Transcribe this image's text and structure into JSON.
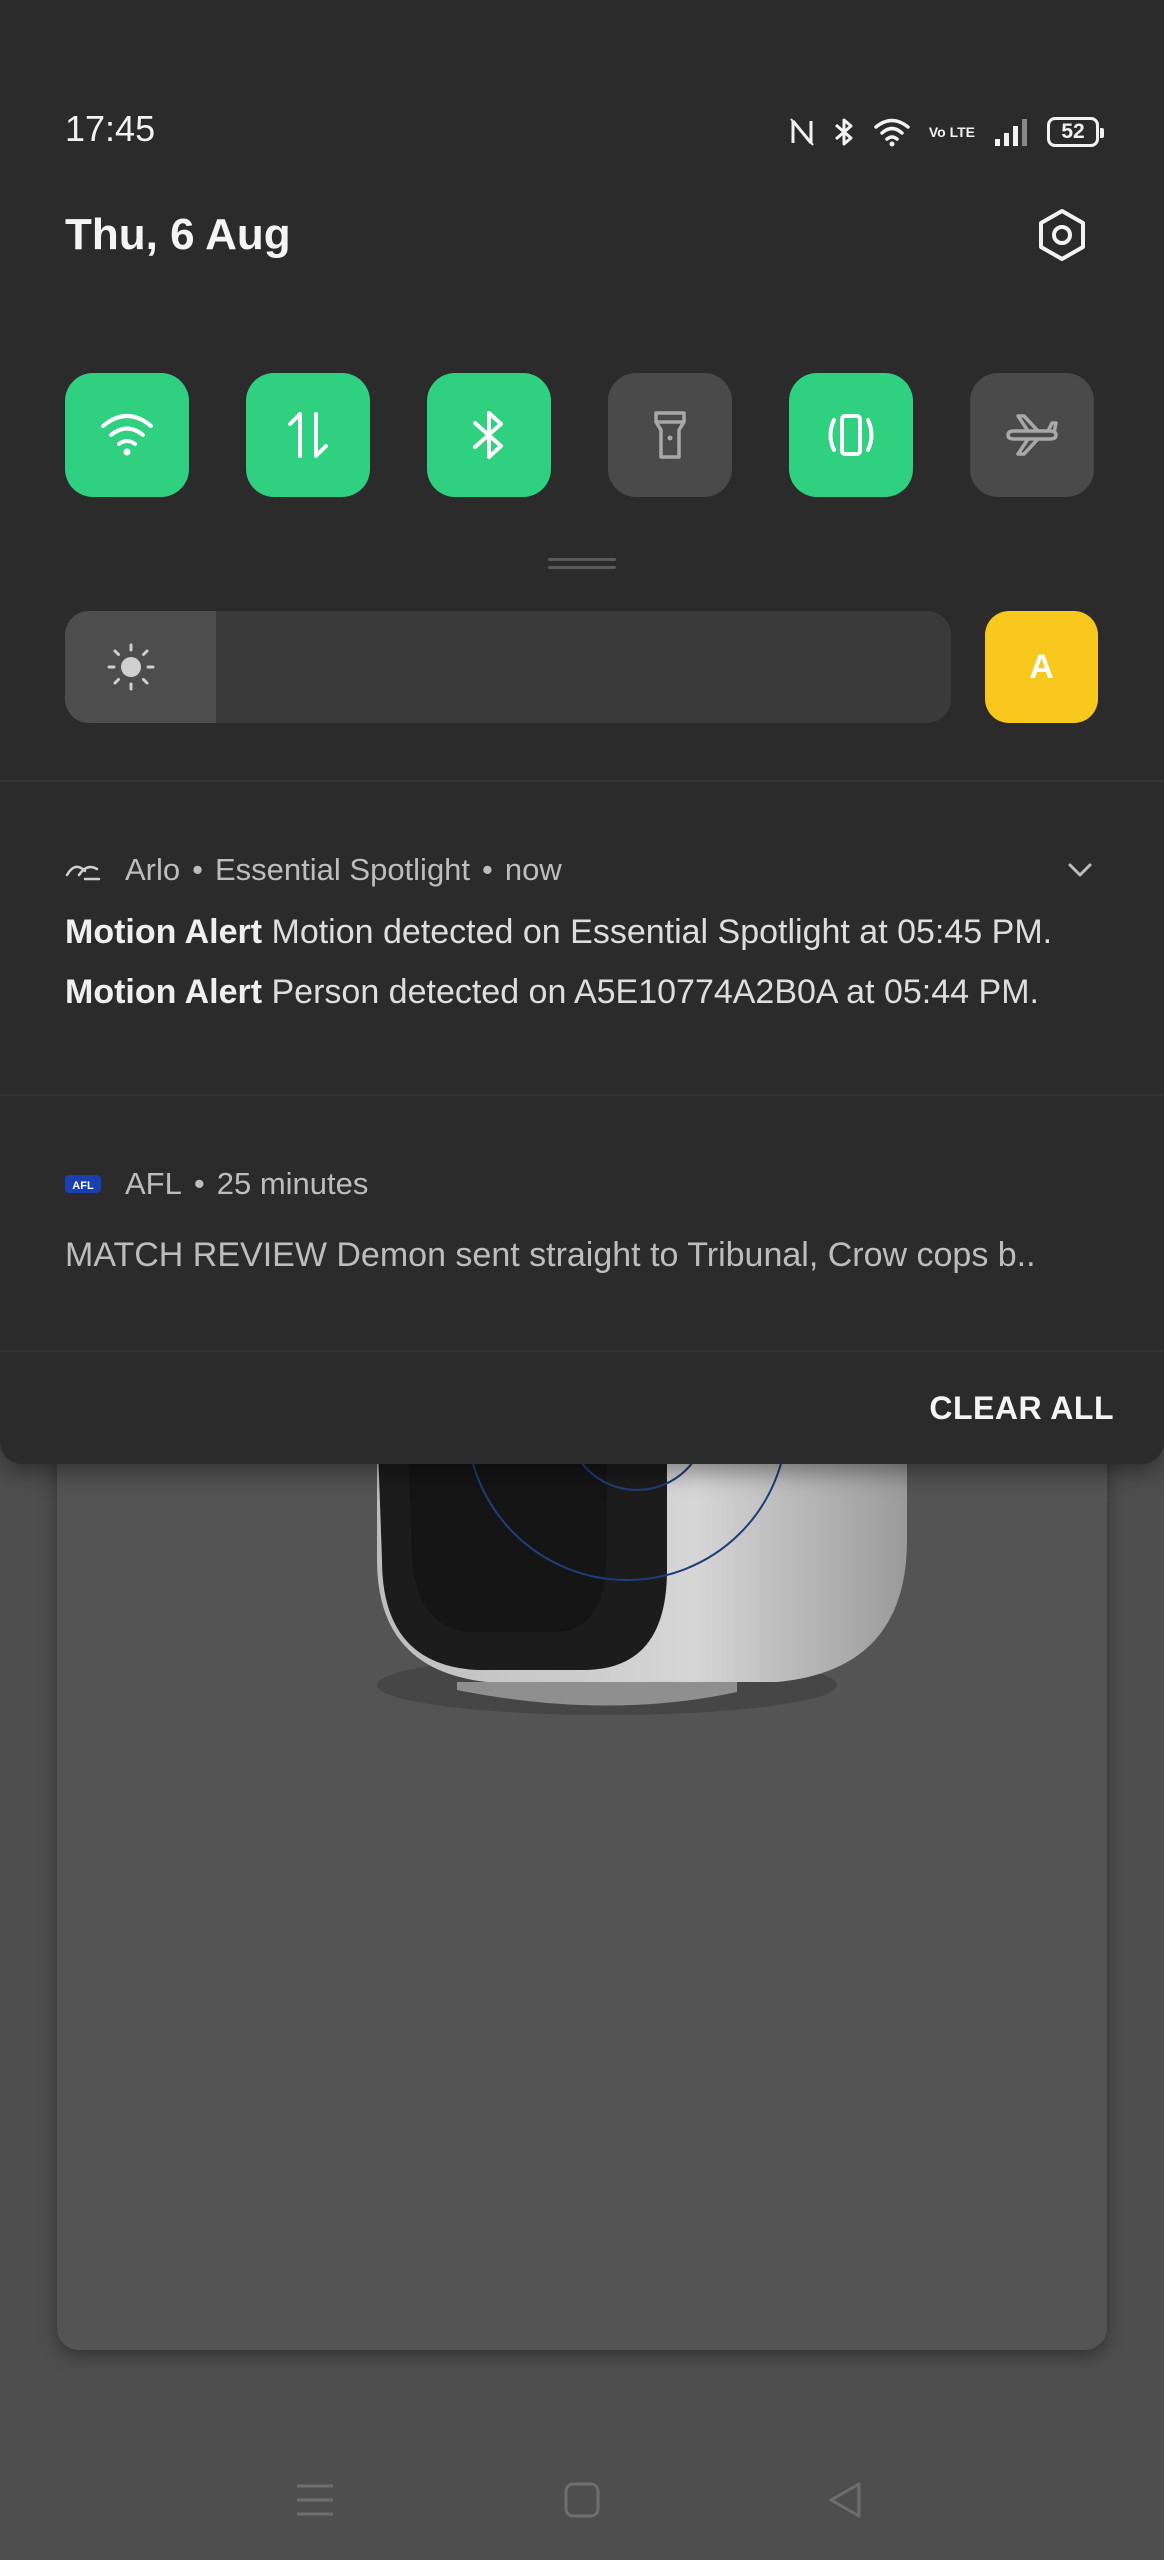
{
  "status_bar": {
    "time": "17:45",
    "battery": "52",
    "network_label": "Vo LTE"
  },
  "header": {
    "date": "Thu, 6 Aug"
  },
  "quick_settings": [
    {
      "name": "wifi-icon",
      "state": "on"
    },
    {
      "name": "mobile-data-icon",
      "state": "on"
    },
    {
      "name": "bluetooth-icon",
      "state": "on"
    },
    {
      "name": "flashlight-icon",
      "state": "off"
    },
    {
      "name": "vibrate-icon",
      "state": "on"
    },
    {
      "name": "airplane-icon",
      "state": "off"
    }
  ],
  "brightness": {
    "level_fraction": 0.17,
    "auto_label": "A"
  },
  "notifications": [
    {
      "app": "Arlo",
      "source": "Essential Spotlight",
      "time": "now",
      "lines": [
        {
          "title": "Motion Alert",
          "text": "Motion detected on Essential Spotlight at 05:45 PM."
        },
        {
          "title": "Motion Alert",
          "text": "Person detected on A5E10774A2B0A at 05:44 PM."
        }
      ]
    },
    {
      "app": "AFL",
      "icon_text": "AFL",
      "time": "25 minutes",
      "text": "MATCH REVIEW Demon sent straight to Tribunal, Crow cops b.."
    }
  ],
  "footer": {
    "clear_all_label": "CLEAR ALL"
  },
  "colors": {
    "accent_green": "#2fd07f",
    "auto_yellow": "#f8c81e",
    "shade_bg": "#2b2b2b"
  }
}
